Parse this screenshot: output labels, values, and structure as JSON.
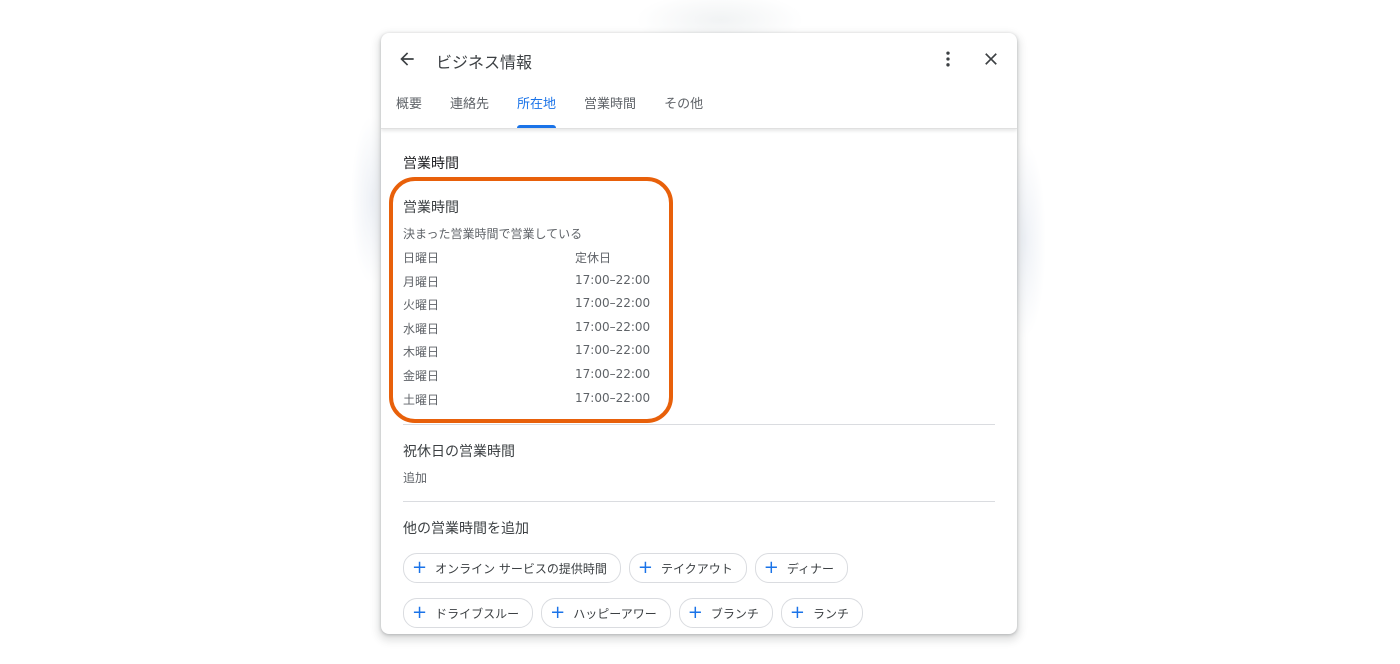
{
  "header": {
    "title": "ビジネス情報",
    "back_icon": "arrow-back-icon",
    "more_icon": "more-vert-icon",
    "close_icon": "close-icon"
  },
  "tabs": [
    {
      "label": "概要",
      "active": false
    },
    {
      "label": "連絡先",
      "active": false
    },
    {
      "label": "所在地",
      "active": true
    },
    {
      "label": "営業時間",
      "active": false
    },
    {
      "label": "その他",
      "active": false
    }
  ],
  "section_title": "営業時間",
  "hours_card": {
    "title": "営業時間",
    "subtitle": "決まった営業時間で営業している",
    "rows": [
      {
        "day": "日曜日",
        "time": "定休日"
      },
      {
        "day": "月曜日",
        "time": "17:00–22:00"
      },
      {
        "day": "火曜日",
        "time": "17:00–22:00"
      },
      {
        "day": "水曜日",
        "time": "17:00–22:00"
      },
      {
        "day": "木曜日",
        "time": "17:00–22:00"
      },
      {
        "day": "金曜日",
        "time": "17:00–22:00"
      },
      {
        "day": "土曜日",
        "time": "17:00–22:00"
      }
    ]
  },
  "holiday": {
    "title": "祝休日の営業時間",
    "add_label": "追加"
  },
  "other_hours": {
    "title": "他の営業時間を追加",
    "chips": [
      "オンライン サービスの提供時間",
      "テイクアウト",
      "ディナー",
      "ドライブスルー",
      "ハッピーアワー",
      "ブランチ",
      "ランチ"
    ]
  },
  "colors": {
    "accent": "#1a73e8",
    "highlight": "#e8600a"
  }
}
